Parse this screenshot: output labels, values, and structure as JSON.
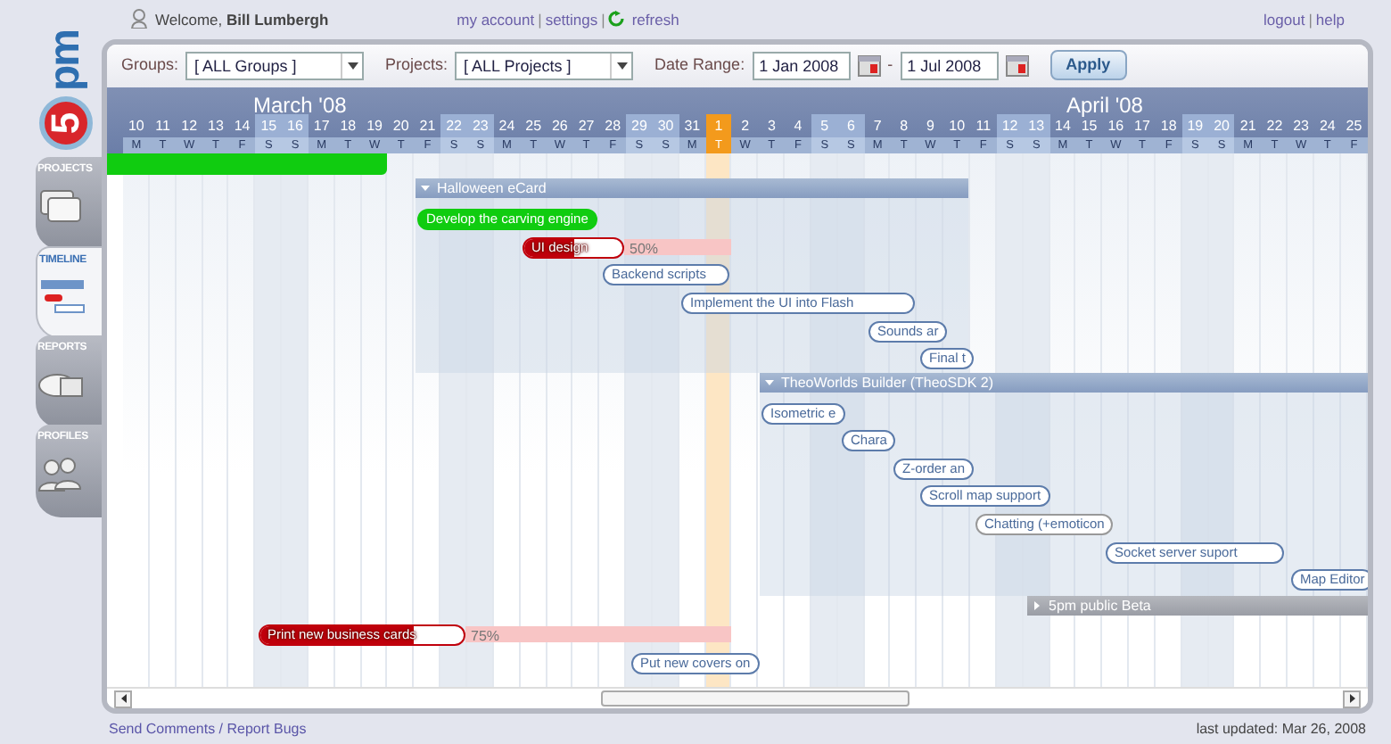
{
  "logo": {
    "number": "5",
    "suffix": "pm"
  },
  "sidebar": {
    "tabs": [
      {
        "label": "PROJECTS",
        "selected": false
      },
      {
        "label": "TIMELINE",
        "selected": true
      },
      {
        "label": "REPORTS",
        "selected": false
      },
      {
        "label": "PROFILES",
        "selected": false
      }
    ]
  },
  "top_bar": {
    "welcome": "Welcome, **Bill Lumbergh**",
    "links": [
      {
        "kind": "link",
        "text": "my account"
      },
      {
        "kind": "separator",
        "text": "|"
      },
      {
        "kind": "link",
        "text": "settings"
      },
      {
        "kind": "separator",
        "text": "|"
      },
      {
        "kind": "refresh",
        "text": "refresh"
      }
    ],
    "right_links": [
      {
        "kind": "link",
        "text": "logout"
      },
      {
        "kind": "separator",
        "text": "|"
      },
      {
        "kind": "link",
        "text": "help"
      }
    ]
  },
  "toolbar": {
    "groups": {
      "label": "Groups:",
      "value": "[ ALL Groups ]"
    },
    "projects": {
      "label": "Projects:",
      "value": "[ ALL Projects ]"
    },
    "date_range": {
      "label": "Date Range:",
      "from": "1 Jan 2008",
      "separator": "-",
      "to": "1 Jul 2008"
    },
    "apply": "Apply"
  },
  "timeline": {
    "months": [
      {
        "label": "March '08"
      },
      {
        "label": "April '08"
      }
    ],
    "days": [
      {
        "day": "10",
        "weekday": "M",
        "weekend": false,
        "today": false
      },
      {
        "day": "11",
        "weekday": "T",
        "weekend": false,
        "today": false
      },
      {
        "day": "12",
        "weekday": "W",
        "weekend": false,
        "today": false
      },
      {
        "day": "13",
        "weekday": "T",
        "weekend": false,
        "today": false
      },
      {
        "day": "14",
        "weekday": "F",
        "weekend": false,
        "today": false
      },
      {
        "day": "15",
        "weekday": "S",
        "weekend": true,
        "today": false
      },
      {
        "day": "16",
        "weekday": "S",
        "weekend": true,
        "today": false
      },
      {
        "day": "17",
        "weekday": "M",
        "weekend": false,
        "today": false
      },
      {
        "day": "18",
        "weekday": "T",
        "weekend": false,
        "today": false
      },
      {
        "day": "19",
        "weekday": "W",
        "weekend": false,
        "today": false
      },
      {
        "day": "20",
        "weekday": "T",
        "weekend": false,
        "today": false
      },
      {
        "day": "21",
        "weekday": "F",
        "weekend": false,
        "today": false
      },
      {
        "day": "22",
        "weekday": "S",
        "weekend": true,
        "today": false
      },
      {
        "day": "23",
        "weekday": "S",
        "weekend": true,
        "today": false
      },
      {
        "day": "24",
        "weekday": "M",
        "weekend": false,
        "today": false
      },
      {
        "day": "25",
        "weekday": "T",
        "weekend": false,
        "today": false
      },
      {
        "day": "26",
        "weekday": "W",
        "weekend": false,
        "today": false
      },
      {
        "day": "27",
        "weekday": "T",
        "weekend": false,
        "today": false
      },
      {
        "day": "28",
        "weekday": "F",
        "weekend": false,
        "today": false
      },
      {
        "day": "29",
        "weekday": "S",
        "weekend": true,
        "today": false
      },
      {
        "day": "30",
        "weekday": "S",
        "weekend": true,
        "today": false
      },
      {
        "day": "31",
        "weekday": "M",
        "weekend": false,
        "today": false
      },
      {
        "day": "1",
        "weekday": "T",
        "weekend": false,
        "today": true
      },
      {
        "day": "2",
        "weekday": "W",
        "weekend": false,
        "today": false
      },
      {
        "day": "3",
        "weekday": "T",
        "weekend": false,
        "today": false
      },
      {
        "day": "4",
        "weekday": "F",
        "weekend": false,
        "today": false
      },
      {
        "day": "5",
        "weekday": "S",
        "weekend": true,
        "today": false
      },
      {
        "day": "6",
        "weekday": "S",
        "weekend": true,
        "today": false
      },
      {
        "day": "7",
        "weekday": "M",
        "weekend": false,
        "today": false
      },
      {
        "day": "8",
        "weekday": "T",
        "weekend": false,
        "today": false
      },
      {
        "day": "9",
        "weekday": "W",
        "weekend": false,
        "today": false
      },
      {
        "day": "10",
        "weekday": "T",
        "weekend": false,
        "today": false
      },
      {
        "day": "11",
        "weekday": "F",
        "weekend": false,
        "today": false
      },
      {
        "day": "12",
        "weekday": "S",
        "weekend": true,
        "today": false
      },
      {
        "day": "13",
        "weekday": "S",
        "weekend": true,
        "today": false
      },
      {
        "day": "14",
        "weekday": "M",
        "weekend": false,
        "today": false
      },
      {
        "day": "15",
        "weekday": "T",
        "weekend": false,
        "today": false
      },
      {
        "day": "16",
        "weekday": "W",
        "weekend": false,
        "today": false
      },
      {
        "day": "17",
        "weekday": "T",
        "weekend": false,
        "today": false
      },
      {
        "day": "18",
        "weekday": "F",
        "weekend": false,
        "today": false
      },
      {
        "day": "19",
        "weekday": "S",
        "weekend": true,
        "today": false
      },
      {
        "day": "20",
        "weekday": "S",
        "weekend": true,
        "today": false
      },
      {
        "day": "21",
        "weekday": "M",
        "weekend": false,
        "today": false
      },
      {
        "day": "22",
        "weekday": "T",
        "weekend": false,
        "today": false
      },
      {
        "day": "23",
        "weekday": "W",
        "weekend": false,
        "today": false
      },
      {
        "day": "24",
        "weekday": "T",
        "weekend": false,
        "today": false
      },
      {
        "day": "25",
        "weekday": "F",
        "weekend": false,
        "today": false
      }
    ]
  },
  "gantt": [
    {
      "kind": "done"
    },
    {
      "kind": "group",
      "label": "Halloween eCard",
      "expanded": true
    },
    {
      "kind": "done",
      "label": "Develop the carving engine"
    },
    {
      "kind": "overdue",
      "label": "UI design",
      "level": 0.5,
      "percent": "50%"
    },
    {
      "kind": "open",
      "label": "Backend scripts"
    },
    {
      "kind": "open",
      "label": "Implement the UI into Flash"
    },
    {
      "kind": "open",
      "label": "Sounds ar"
    },
    {
      "kind": "open",
      "label": "Final t"
    },
    {
      "kind": "group",
      "label": "TheoWorlds Builder (TheoSDK 2)",
      "expanded": true
    },
    {
      "kind": "open",
      "label": "Isometric e"
    },
    {
      "kind": "open",
      "label": "Chara"
    },
    {
      "kind": "open",
      "label": "Z-order an"
    },
    {
      "kind": "open",
      "label": "Scroll map support"
    },
    {
      "kind": "pending",
      "label": "Chatting (+emoticon"
    },
    {
      "kind": "open",
      "label": "Socket server suport"
    },
    {
      "kind": "open",
      "label": "Map Editor"
    },
    {
      "kind": "group",
      "label": "5pm public Beta",
      "expanded": false
    },
    {
      "kind": "overdue",
      "label": "Print new business cards",
      "level": 0.75,
      "percent": "75%"
    },
    {
      "kind": "open",
      "label": "Put new covers on"
    }
  ],
  "footer": {
    "link": "Send Comments / Report Bugs",
    "updated": "last updated: Mar 26, 2008"
  }
}
